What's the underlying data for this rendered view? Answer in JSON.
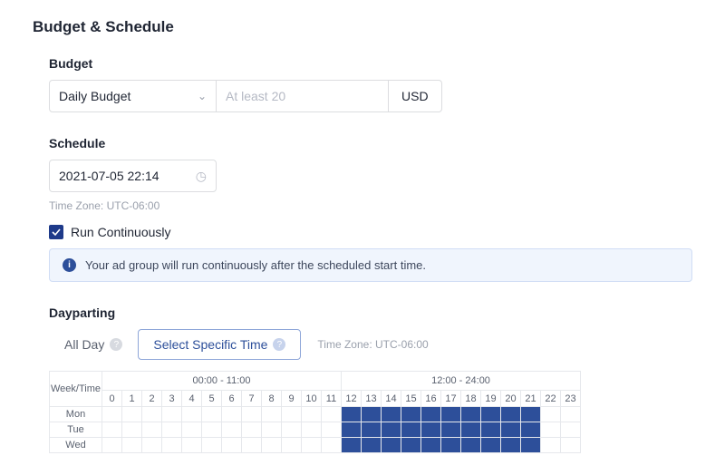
{
  "section_title": "Budget & Schedule",
  "budget": {
    "label": "Budget",
    "type_value": "Daily Budget",
    "amount_placeholder": "At least 20",
    "currency": "USD"
  },
  "schedule": {
    "label": "Schedule",
    "datetime": "2021-07-05 22:14",
    "timezone_label": "Time Zone: UTC-06:00",
    "run_continuously_label": "Run Continuously",
    "run_continuously_checked": true,
    "info_text": "Your ad group will run continuously after the scheduled start time."
  },
  "dayparting": {
    "label": "Dayparting",
    "tab_allday": "All Day",
    "tab_specific": "Select Specific Time",
    "active_tab": "specific",
    "timezone_label": "Time Zone: UTC-06:00",
    "week_time_header": "Week/Time",
    "group1": "00:00 - 11:00",
    "group2": "12:00 - 24:00",
    "hours": [
      "0",
      "1",
      "2",
      "3",
      "4",
      "5",
      "6",
      "7",
      "8",
      "9",
      "10",
      "11",
      "12",
      "13",
      "14",
      "15",
      "16",
      "17",
      "18",
      "19",
      "20",
      "21",
      "22",
      "23"
    ],
    "days": [
      "Mon",
      "Tue",
      "Wed"
    ],
    "selection": {
      "Mon": [
        12,
        13,
        14,
        15,
        16,
        17,
        18,
        19,
        20,
        21
      ],
      "Tue": [
        12,
        13,
        14,
        15,
        16,
        17,
        18,
        19,
        20,
        21
      ],
      "Wed": [
        12,
        13,
        14,
        15,
        16,
        17,
        18,
        19,
        20,
        21
      ]
    }
  }
}
